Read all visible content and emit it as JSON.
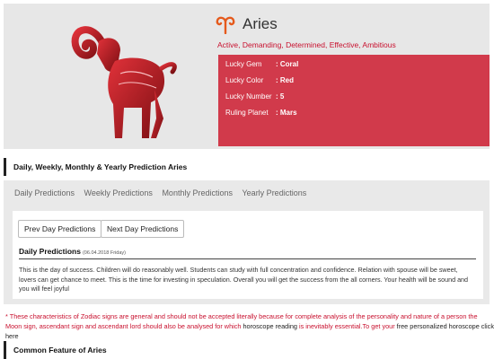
{
  "sign": {
    "name": "Aries",
    "glyph_icon": "aries-symbol-icon",
    "image_icon": "ram-illustration",
    "traits": "Active, Demanding, Determined, Effective, Ambitious",
    "accent_color": "#c8102e"
  },
  "lucky": {
    "box_color": "#d13a4b",
    "rows": [
      {
        "label": "Lucky Gem",
        "value": ": Coral"
      },
      {
        "label": "Lucky Color",
        "value": ": Red"
      },
      {
        "label": "Lucky Number",
        "value": ": 5"
      },
      {
        "label": "Ruling Planet",
        "value": ": Mars"
      }
    ]
  },
  "prediction_section": {
    "heading": "Daily, Weekly, Monthly & Yearly Prediction Aries",
    "tabs": [
      "Daily Predictions",
      "Weekly Predictions",
      "Monthly Predictions",
      "Yearly Predictions"
    ],
    "prev_button": "Prev Day Predictions",
    "next_button": "Next Day Predictions",
    "card_title": "Daily Predictions",
    "card_date": "(06.04.2018 Friday)",
    "card_text": "This is the day of success. Children will do reasonably well. Students can study with full concentration and confidence. Relation with spouse will be sweet, lovers can get chance to meet. This is the time for investing in speculation. Overall you will get the success from the all corners. Your health will be sound and you will feel joyful"
  },
  "disclaimer": {
    "text_part1": "* These characteristics of Zodiac signs are general and should not be accepted literally because for complete analysis of the personality and nature of a person the Moon sign, ascendant sign and ascendant lord should also be analysed for which ",
    "link1": "horoscope reading",
    "text_part2": " is inevitably essential.To get your ",
    "link2": "free personalized horoscope click here"
  },
  "common_section": {
    "heading": "Common Feature of Aries"
  }
}
